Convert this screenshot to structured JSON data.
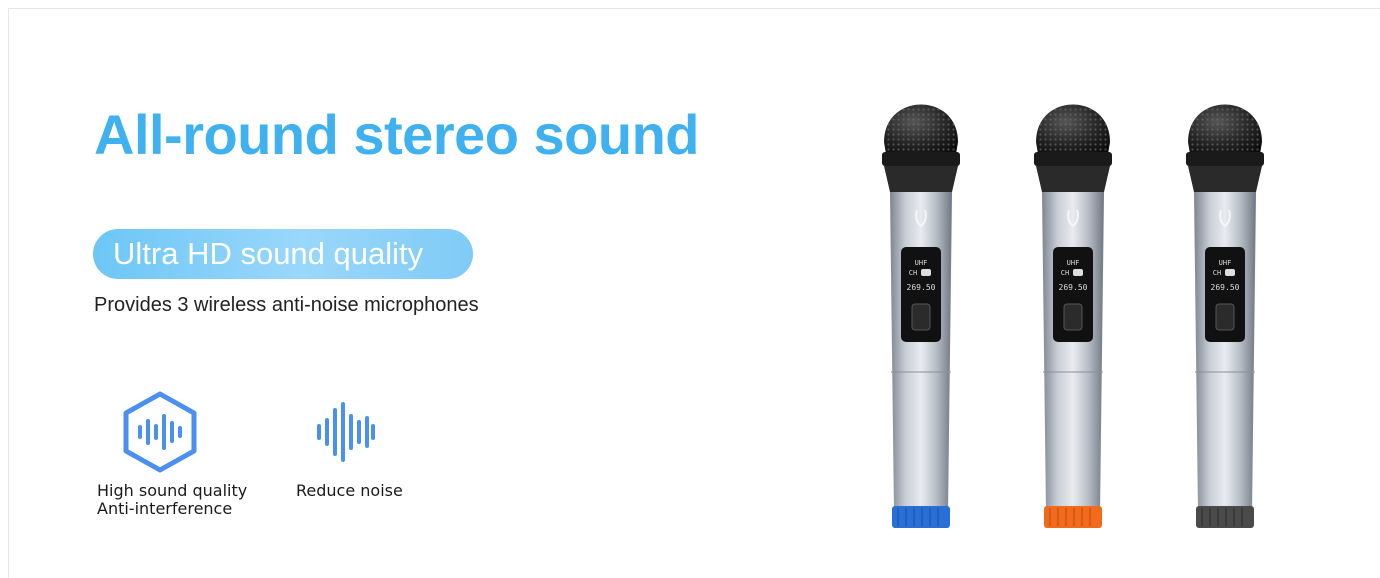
{
  "hero": {
    "headline": "All-round stereo sound",
    "badge": "Ultra HD sound quality",
    "description": "Provides 3 wireless anti-noise microphones"
  },
  "features": [
    {
      "icon": "hexagon-soundwave-icon",
      "lines": [
        "High sound quality",
        "Anti-interference"
      ]
    },
    {
      "icon": "soundwave-icon",
      "lines": [
        "Reduce noise"
      ]
    }
  ],
  "product": {
    "microphones": [
      {
        "ring_color": "#2a6fd6",
        "display_band": "UHF",
        "display_ch": "CH",
        "display_freq": "269.50"
      },
      {
        "ring_color": "#f26a1b",
        "display_band": "UHF",
        "display_ch": "CH",
        "display_freq": "269.50"
      },
      {
        "ring_color": "#4a4a4a",
        "display_band": "UHF",
        "display_ch": "CH",
        "display_freq": "269.50"
      }
    ]
  },
  "colors": {
    "accent": "#3fb0f0",
    "icon_blue": "#4a90f0",
    "text": "#222222"
  }
}
